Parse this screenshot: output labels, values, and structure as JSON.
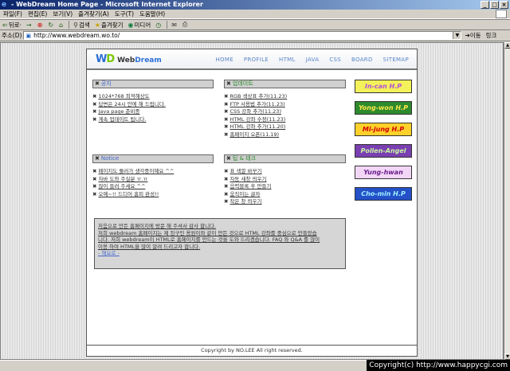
{
  "window": {
    "title": "- WebDream Home Page - Microsoft Internet Explorer",
    "buttons": [
      "_",
      "□",
      "×"
    ]
  },
  "menu": [
    "파일(F)",
    "편집(E)",
    "보기(V)",
    "즐겨찾기(A)",
    "도구(T)",
    "도움말(H)"
  ],
  "toolbar": {
    "back": "뒤로",
    "search": "검색",
    "favorites": "즐겨찾기",
    "media": "미디어"
  },
  "address": {
    "label": "주소(D)",
    "url": "http://www.webdream.wo.to/",
    "go": "이동",
    "links": "링크"
  },
  "site": {
    "logo_mark_w": "W",
    "logo_mark_d": "D",
    "logo_word_web": "Web",
    "logo_word_dream": "Dream",
    "nav": [
      "HOME",
      "PROFILE",
      "HTML",
      "JAVA",
      "CSS",
      "BOARD",
      "SITEMAP"
    ],
    "sections": {
      "notice_kr": {
        "title": "공지",
        "items": [
          "1024*768 최적해상도",
          "답변은 24시 안에 해 드립니다.",
          "Java page 준비중",
          "계속 업데이트 됩니다."
        ]
      },
      "update": {
        "title": "업데이트",
        "items": [
          "RGB 색상표 추가(11.23)",
          "FTP 사용법 추가(11.23)",
          "CSS 강좌 추가(11.23)",
          "HTML 강좌 수정(11.23)",
          "HTML 강좌 추가(11.20)",
          "홈페이지 오픈(11.19)"
        ]
      },
      "notice_en": {
        "title": "Notice",
        "items": [
          "페이지도 둘러가 생각중이예요 ^^",
          "자바 도와 주실분 ㅠ.ㅠ",
          "많이 들러 주세요 ^^",
          "오예~!! 드디어 홈피 완성!!"
        ]
      },
      "tips": {
        "title": "팁 & 테크",
        "items": [
          "표 색깔 바꾸기",
          "자동 새창 띄우기",
          "음력블록 후 만들기",
          "움직이는 글자",
          "작은 창 띄우기"
        ]
      }
    },
    "banners": [
      {
        "label": "In-can H.P",
        "bg": "#f3f25a",
        "fg": "#b54fd8"
      },
      {
        "label": "Yong-won H.P",
        "bg": "#2d8a2d",
        "fg": "#ffe94a"
      },
      {
        "label": "Mi-jung H.P",
        "bg": "#ffd12a",
        "fg": "#d00000"
      },
      {
        "label": "Pollen-Angel",
        "bg": "#7a3fb0",
        "fg": "#c8f7a0"
      },
      {
        "label": "Yung-hwan",
        "bg": "#f2d6f6",
        "fg": "#6a1d8c"
      },
      {
        "label": "Cho-min H.P",
        "bg": "#2450c8",
        "fg": "#9ff1ff"
      }
    ],
    "message": {
      "lines": [
        "처음으로 만든 홈페이지에 방문 해 주셔서 감사 합니다.",
        "저희 webdream 홈페이지는 제 친구인 용원이와 같이 만든 것으로 HTML 강좌를 중심으로 만들었습",
        "니다. 저희 webdream이 HTML로 홈페이지를 만드는 것을 도와 드리겠습니다. FAQ 와 Q&A 를 많이",
        "이용 하여 HTML을 많이 알려 드리고자 합니다."
      ],
      "more": "- 해요로 -"
    },
    "footer": "Copyright by NO.LEE All right reserved."
  },
  "status": {
    "text": "",
    "copyright": "Copyright(c) http://www.happycgi.com"
  }
}
